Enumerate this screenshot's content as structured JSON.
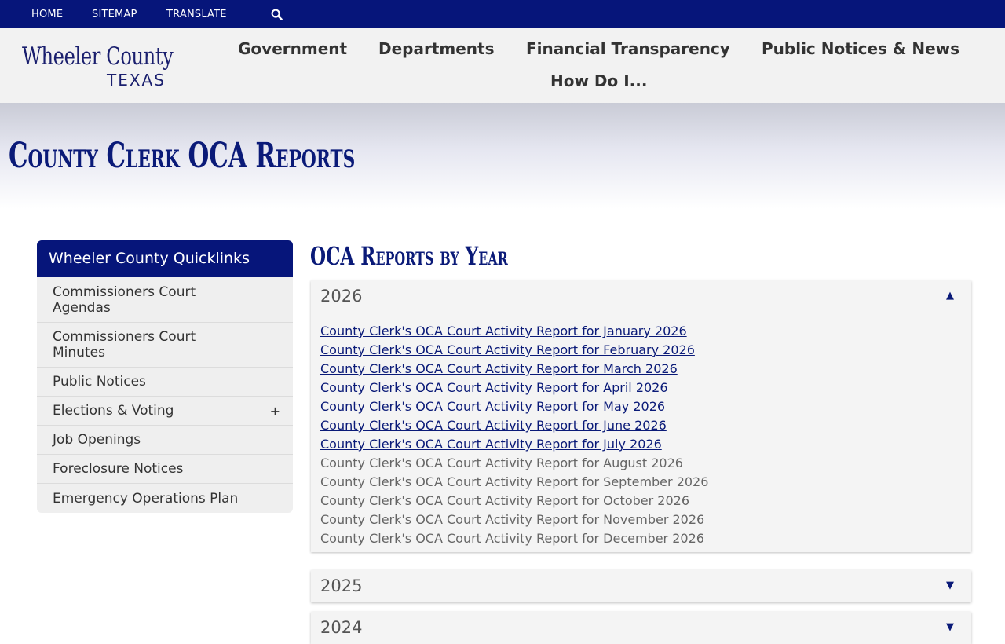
{
  "topbar": {
    "home": "HOME",
    "sitemap": "SITEMAP",
    "translate": "TRANSLATE"
  },
  "logo": {
    "line1": "Wheeler County",
    "line2": "TEXAS"
  },
  "mainnav": {
    "government": "Government",
    "departments": "Departments",
    "financial": "Financial Transparency",
    "notices": "Public Notices & News",
    "howdoi": "How Do I..."
  },
  "page": {
    "title": "County Clerk OCA Reports",
    "section_title": "OCA Reports by Year"
  },
  "sidebar": {
    "heading": "Wheeler County Quicklinks",
    "items": [
      {
        "label": "Commissioners Court Agendas"
      },
      {
        "label": "Commissioners Court Minutes"
      },
      {
        "label": "Public Notices"
      },
      {
        "label": "Elections & Voting",
        "expand": "+"
      },
      {
        "label": "Job Openings"
      },
      {
        "label": "Foreclosure Notices"
      },
      {
        "label": "Emergency Operations Plan"
      }
    ]
  },
  "accordion": {
    "years": [
      {
        "year": "2026",
        "arrow": "▲",
        "reports": [
          {
            "label": "County Clerk's OCA Court Activity Report for January 2026",
            "linked": true
          },
          {
            "label": "County Clerk's OCA Court Activity Report for February 2026",
            "linked": true
          },
          {
            "label": "County Clerk's OCA Court Activity Report for March 2026",
            "linked": true
          },
          {
            "label": "County Clerk's OCA Court Activity Report for April 2026",
            "linked": true
          },
          {
            "label": "County Clerk's OCA Court Activity Report for May 2026",
            "linked": true
          },
          {
            "label": "County Clerk's OCA Court Activity Report for June 2026",
            "linked": true
          },
          {
            "label": "County Clerk's OCA Court Activity Report for July 2026",
            "linked": true
          },
          {
            "label": "County Clerk's OCA Court Activity Report for August 2026",
            "linked": false
          },
          {
            "label": "County Clerk's OCA Court Activity Report for September 2026",
            "linked": false
          },
          {
            "label": "County Clerk's OCA Court Activity Report for October 2026",
            "linked": false
          },
          {
            "label": "County Clerk's OCA Court Activity Report for November 2026",
            "linked": false
          },
          {
            "label": "County Clerk's OCA Court Activity Report for December 2026",
            "linked": false
          }
        ]
      },
      {
        "year": "2025",
        "arrow": "▼"
      },
      {
        "year": "2024",
        "arrow": "▼"
      }
    ]
  },
  "colors": {
    "brand_navy": "#06157a",
    "link": "#0a1a78",
    "disabled_text": "#666666"
  }
}
